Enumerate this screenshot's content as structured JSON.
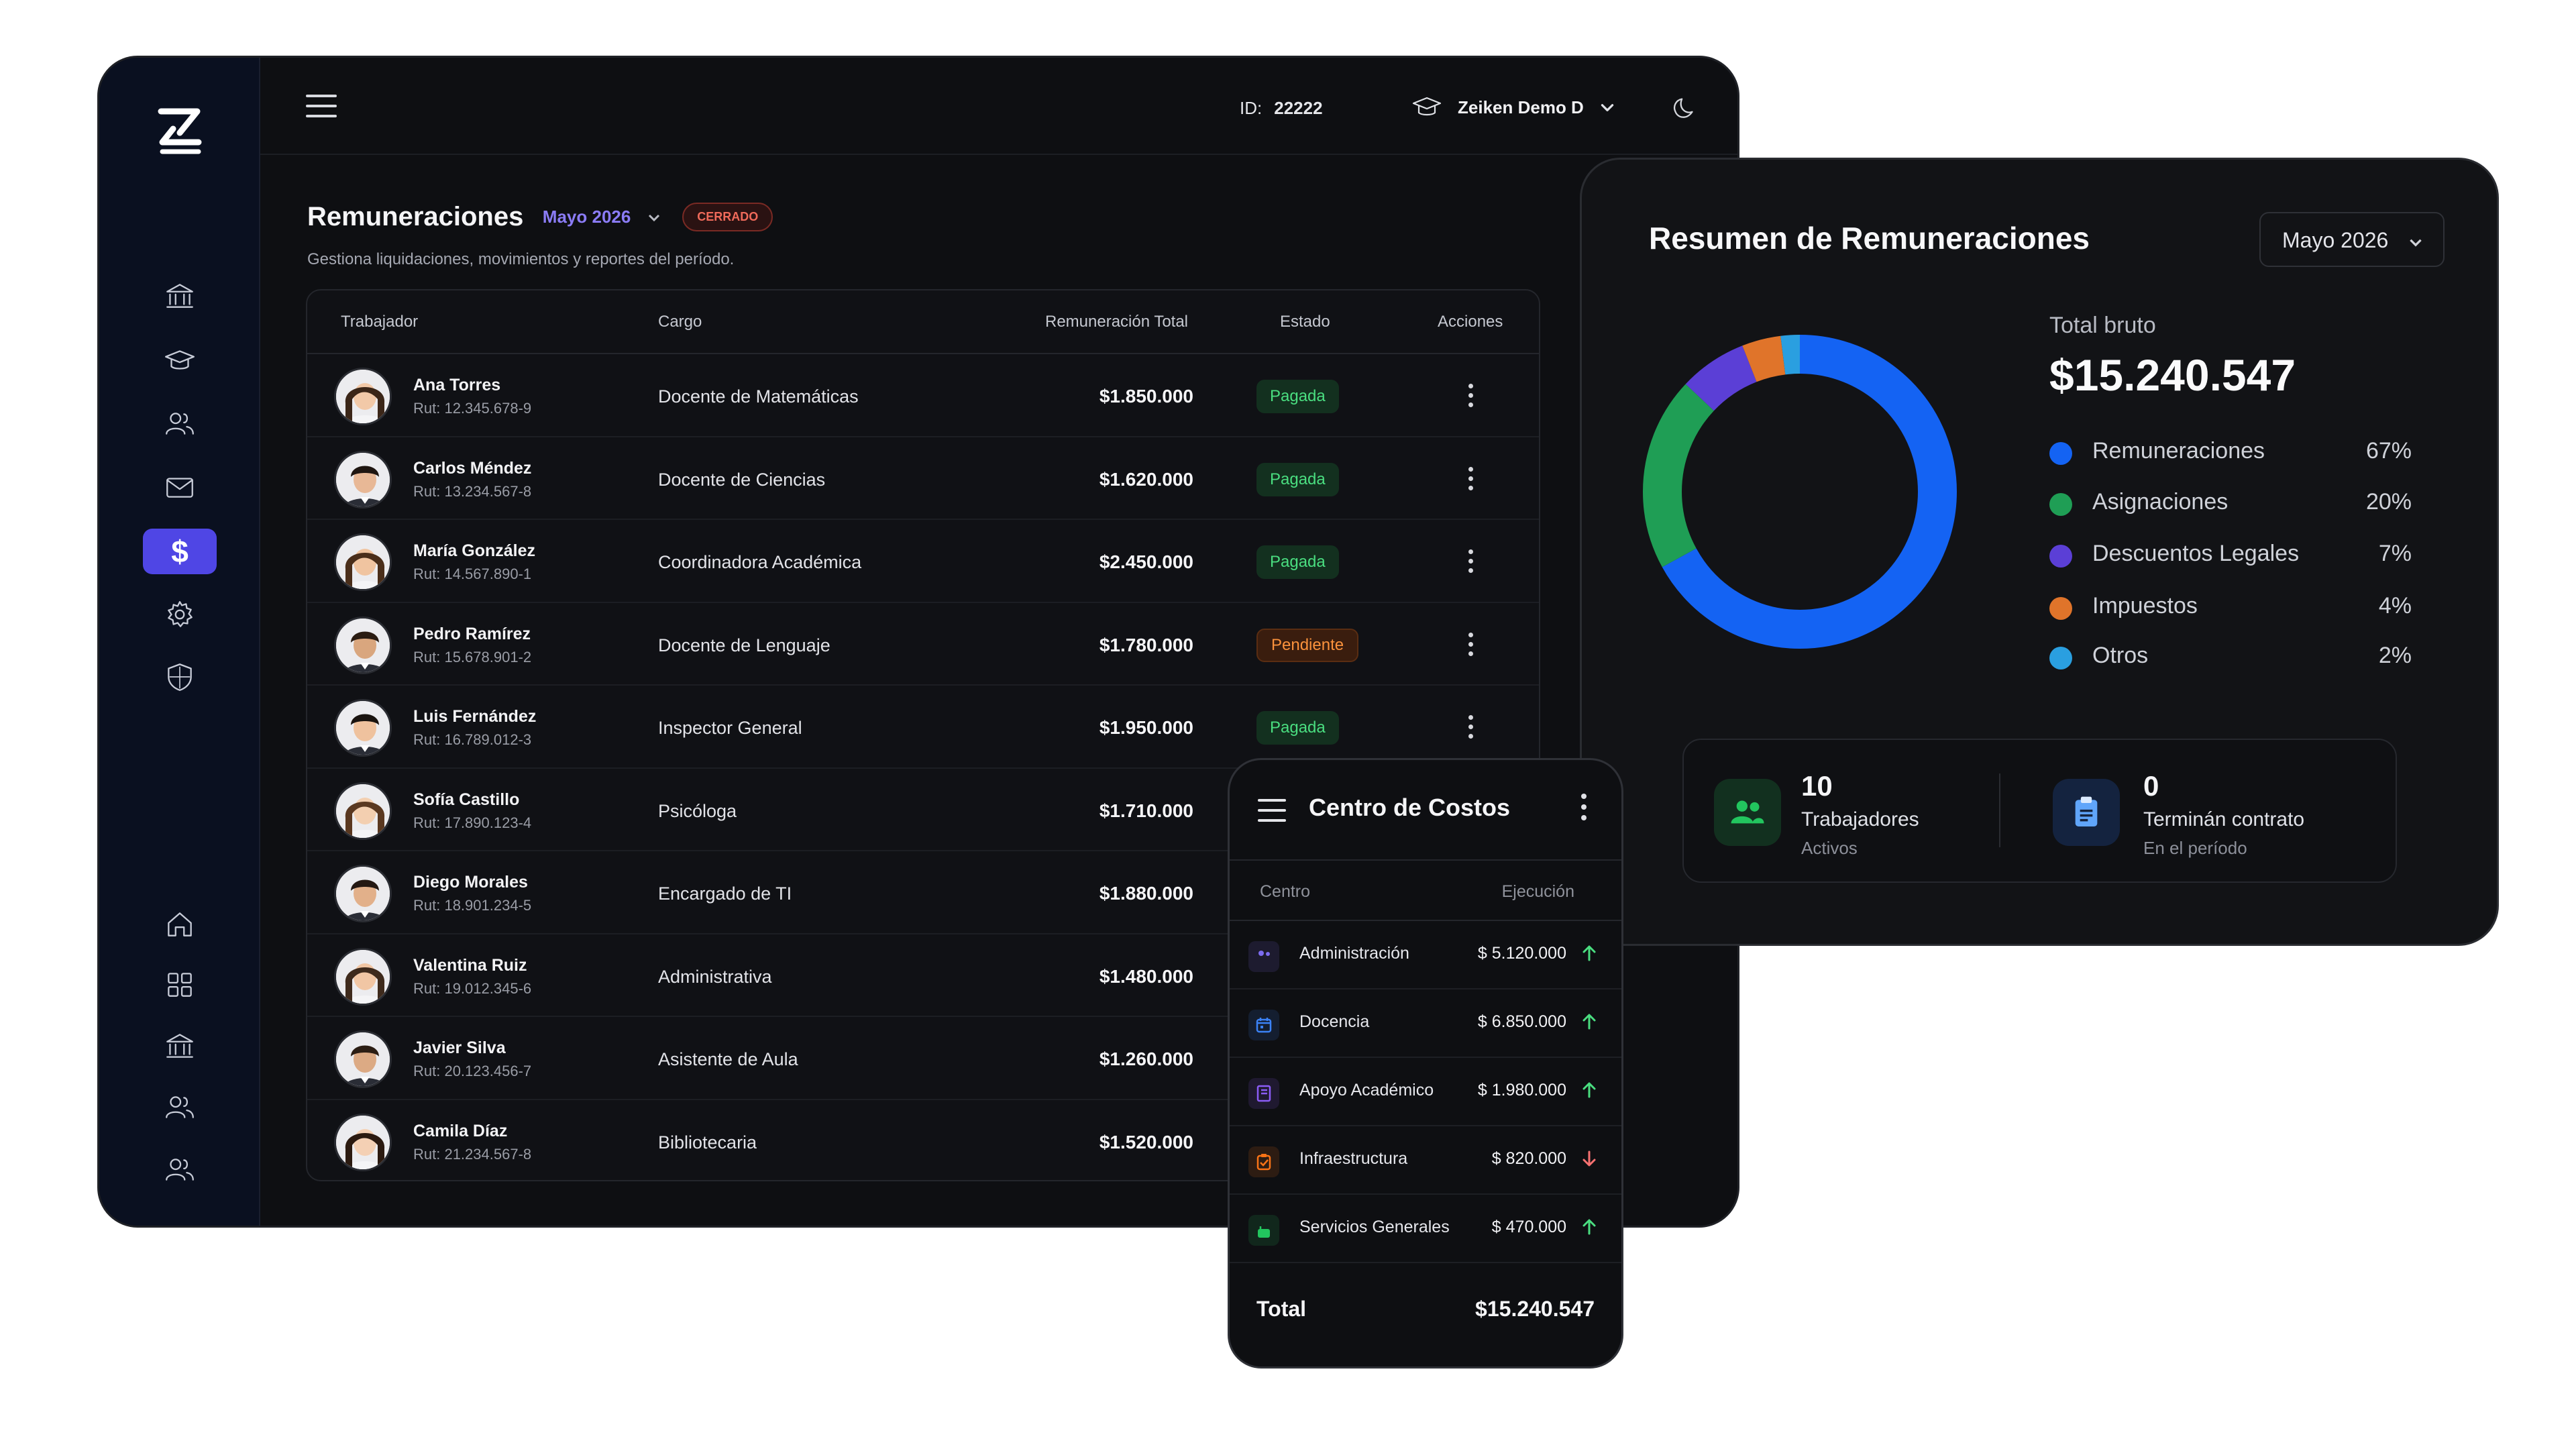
{
  "header": {
    "id_label": "ID:",
    "id_value": "22222",
    "org_name": "Zeiken Demo D"
  },
  "page": {
    "title": "Remuneraciones",
    "period": "Mayo 2026",
    "status_badge": "CERRADO",
    "subtitle": "Gestiona liquidaciones, movimientos y reportes del período."
  },
  "table": {
    "columns": [
      "Trabajador",
      "Cargo",
      "Remuneración Total",
      "Estado",
      "Acciones"
    ],
    "rows": [
      {
        "name": "Ana Torres",
        "rut": "Rut: 12.345.678-9",
        "cargo": "Docente de Matemáticas",
        "total": "$1.850.000",
        "estado": "Pagada",
        "gender": "f"
      },
      {
        "name": "Carlos Méndez",
        "rut": "Rut: 13.234.567-8",
        "cargo": "Docente de Ciencias",
        "total": "$1.620.000",
        "estado": "Pagada",
        "gender": "m"
      },
      {
        "name": "María González",
        "rut": "Rut: 14.567.890-1",
        "cargo": "Coordinadora Académica",
        "total": "$2.450.000",
        "estado": "Pagada",
        "gender": "f"
      },
      {
        "name": "Pedro Ramírez",
        "rut": "Rut: 15.678.901-2",
        "cargo": "Docente de Lenguaje",
        "total": "$1.780.000",
        "estado": "Pendiente",
        "gender": "m"
      },
      {
        "name": "Luis Fernández",
        "rut": "Rut: 16.789.012-3",
        "cargo": "Inspector General",
        "total": "$1.950.000",
        "estado": "Pagada",
        "gender": "m"
      },
      {
        "name": "Sofía Castillo",
        "rut": "Rut: 17.890.123-4",
        "cargo": "Psicóloga",
        "total": "$1.710.000",
        "estado": "",
        "gender": "f"
      },
      {
        "name": "Diego Morales",
        "rut": "Rut: 18.901.234-5",
        "cargo": "Encargado de TI",
        "total": "$1.880.000",
        "estado": "",
        "gender": "m"
      },
      {
        "name": "Valentina Ruiz",
        "rut": "Rut: 19.012.345-6",
        "cargo": "Administrativa",
        "total": "$1.480.000",
        "estado": "",
        "gender": "f"
      },
      {
        "name": "Javier Silva",
        "rut": "Rut: 20.123.456-7",
        "cargo": "Asistente de Aula",
        "total": "$1.260.000",
        "estado": "",
        "gender": "m"
      },
      {
        "name": "Camila Díaz",
        "rut": "Rut: 21.234.567-8",
        "cargo": "Bibliotecaria",
        "total": "$1.520.000",
        "estado": "",
        "gender": "f"
      }
    ]
  },
  "summary": {
    "title": "Resumen de Remuneraciones",
    "period_select": "Mayo 2026",
    "total_label": "Total bruto",
    "total_value": "$15.240.547",
    "legend": [
      {
        "name": "Remuneraciones",
        "pct": "67%",
        "value": 67,
        "color": "#1463f3"
      },
      {
        "name": "Asignaciones",
        "pct": "20%",
        "value": 20,
        "color": "#1f9e55"
      },
      {
        "name": "Descuentos Legales",
        "pct": "7%",
        "value": 7,
        "color": "#5b3fd6"
      },
      {
        "name": "Impuestos",
        "pct": "4%",
        "value": 4,
        "color": "#e0742a"
      },
      {
        "name": "Otros",
        "pct": "2%",
        "value": 2,
        "color": "#2a9fe0"
      }
    ],
    "stats": [
      {
        "value": "10",
        "label": "Trabajadores",
        "sub": "Activos"
      },
      {
        "value": "0",
        "label": "Terminán contrato",
        "sub": "En el período"
      }
    ]
  },
  "costs": {
    "title": "Centro de Costos",
    "col_centro": "Centro",
    "col_ejecucion": "Ejecución",
    "rows": [
      {
        "name": "Administración",
        "value": "$ 5.120.000",
        "trend": "up",
        "icon": "users-icon",
        "color": "#7c6cf0"
      },
      {
        "name": "Docencia",
        "value": "$ 6.850.000",
        "trend": "up",
        "icon": "calendar-icon",
        "color": "#3b82f6"
      },
      {
        "name": "Apoyo Académico",
        "value": "$ 1.980.000",
        "trend": "up",
        "icon": "book-icon",
        "color": "#8b5cf6"
      },
      {
        "name": "Infraestructura",
        "value": "$ 820.000",
        "trend": "down",
        "icon": "clipboard-icon",
        "color": "#f97316"
      },
      {
        "name": "Servicios Generales",
        "value": "$ 470.000",
        "trend": "up",
        "icon": "lock-icon",
        "color": "#22c55e"
      }
    ],
    "total_label": "Total",
    "total_value": "$15.240.547"
  }
}
